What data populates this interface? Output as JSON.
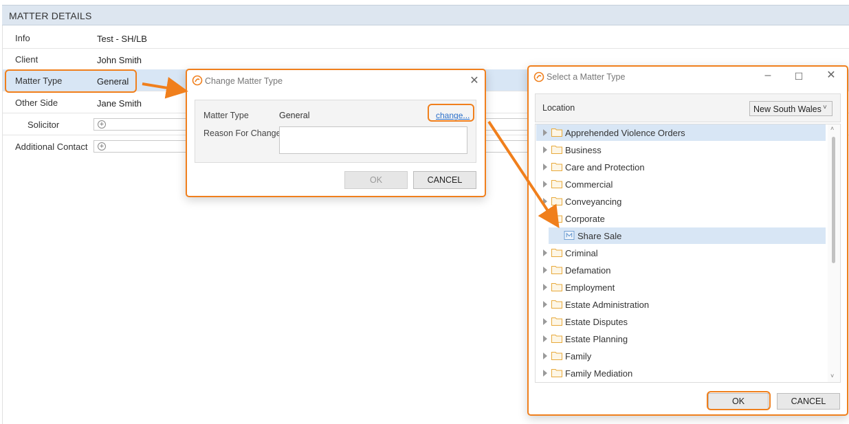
{
  "matter_details": {
    "header": "MATTER DETAILS",
    "rows": [
      {
        "label": "Info",
        "value": "Test - SH/LB"
      },
      {
        "label": "Client",
        "value": "John Smith"
      },
      {
        "label": "Matter Type",
        "value": "General"
      },
      {
        "label": "Other Side",
        "value": "Jane Smith"
      },
      {
        "label": "Solicitor",
        "value": ""
      },
      {
        "label": "Additional Contact",
        "value": ""
      }
    ]
  },
  "change_dialog": {
    "title": "Change Matter Type",
    "matter_type_label": "Matter Type",
    "matter_type_value": "General",
    "change_link": "change...",
    "reason_label": "Reason For Change",
    "reason_value": "",
    "ok_label": "OK",
    "cancel_label": "CANCEL"
  },
  "select_dialog": {
    "title": "Select a Matter Type",
    "location_label": "Location",
    "location_value": "New South Wales",
    "tree": [
      {
        "label": "Apprehended Violence Orders",
        "type": "folder",
        "expanded": false
      },
      {
        "label": "Business",
        "type": "folder",
        "expanded": false
      },
      {
        "label": "Care and Protection",
        "type": "folder",
        "expanded": false
      },
      {
        "label": "Commercial",
        "type": "folder",
        "expanded": false
      },
      {
        "label": "Conveyancing",
        "type": "folder",
        "expanded": false
      },
      {
        "label": "Corporate",
        "type": "folder",
        "expanded": true
      },
      {
        "label": "Share Sale",
        "type": "matter",
        "selected": true
      },
      {
        "label": "Criminal",
        "type": "folder",
        "expanded": false
      },
      {
        "label": "Defamation",
        "type": "folder",
        "expanded": false
      },
      {
        "label": "Employment",
        "type": "folder",
        "expanded": false
      },
      {
        "label": "Estate Administration",
        "type": "folder",
        "expanded": false
      },
      {
        "label": "Estate Disputes",
        "type": "folder",
        "expanded": false
      },
      {
        "label": "Estate Planning",
        "type": "folder",
        "expanded": false
      },
      {
        "label": "Family",
        "type": "folder",
        "expanded": false
      },
      {
        "label": "Family Mediation",
        "type": "folder",
        "expanded": false
      }
    ],
    "ok_label": "OK",
    "cancel_label": "CANCEL"
  },
  "colors": {
    "highlight": "#f07f1c",
    "selected_row": "#d8e6f5",
    "header_bg": "#dde6f0",
    "link": "#2a6fc9",
    "folder": "#e8a93a"
  }
}
